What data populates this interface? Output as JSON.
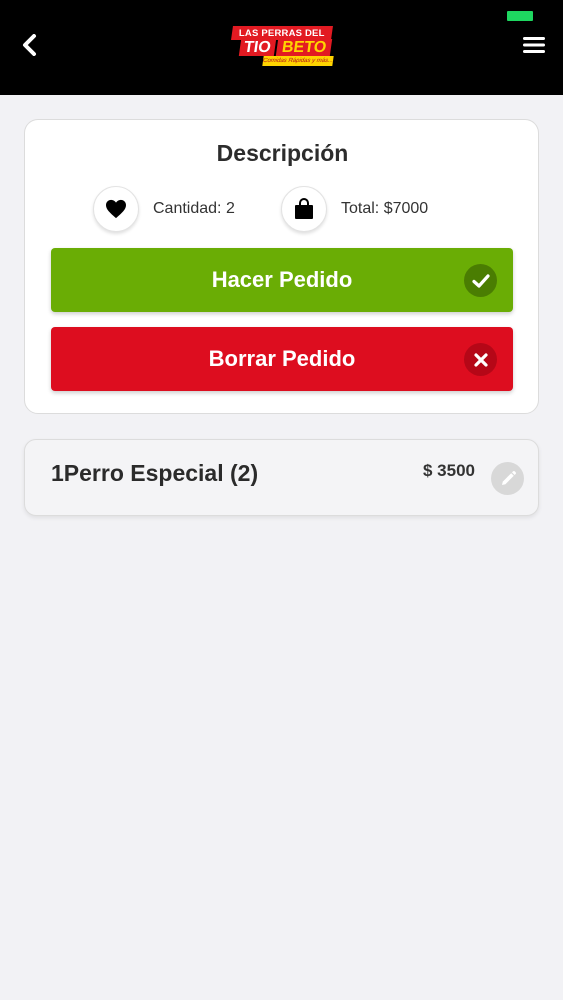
{
  "header": {
    "back_icon": "chevron-left-icon",
    "menu_icon": "hamburger-menu-icon",
    "logo": {
      "top_text": "LAS PERRAS DEL",
      "tio_text": "TIO",
      "beto_text": "BETO",
      "tagline": "Comidas Rápidas y más..."
    }
  },
  "summary": {
    "title": "Descripción",
    "quantity_label": "Cantidad: 2",
    "total_label": "Total: $7000",
    "quantity_icon": "heart-icon",
    "total_icon": "shopping-bag-icon"
  },
  "actions": {
    "place_order_label": "Hacer Pedido",
    "delete_order_label": "Borrar Pedido"
  },
  "items": [
    {
      "name": "1Perro Especial (2)",
      "price": "$ 3500"
    }
  ],
  "colors": {
    "header_bg": "#000000",
    "place_order": "#6aad05",
    "delete_order": "#dd0d1f",
    "battery": "#1ed760"
  }
}
